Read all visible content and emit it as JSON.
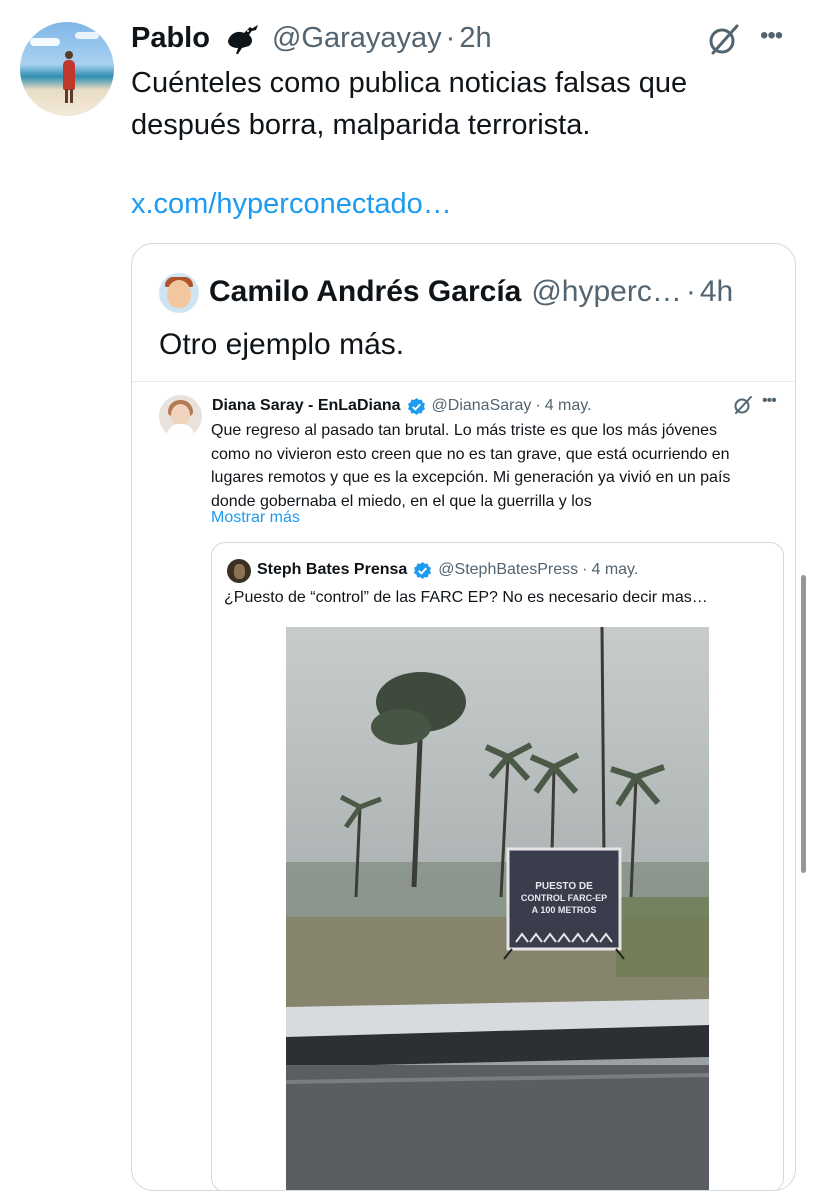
{
  "tweet": {
    "author_name": "Pablo",
    "author_handle": "@Garayayay",
    "separator": "·",
    "time": "2h",
    "text": "Cuénteles como publica noticias falsas que después borra, malparida terrorista.",
    "link_text": "x.com/hyperconectado…",
    "icons": {
      "badge": "bird-emoji-icon",
      "grok": "grok-icon",
      "more": "more-icon"
    }
  },
  "quote": {
    "author_name": "Camilo Andrés García",
    "author_handle": "@hyperc…",
    "separator": "·",
    "time": "4h",
    "text": "Otro ejemplo más.",
    "screenshot": {
      "author_name": "Diana Saray - EnLaDiana",
      "author_handle": "@DianaSaray",
      "separator": "·",
      "time": "4 may.",
      "lines": [
        "Que regreso al pasado tan brutal. Lo más triste es que los más jóvenes",
        "como no vivieron esto creen que no es tan grave, que está ocurriendo en",
        "lugares remotos y que es la excepción. Mi generación ya vivió en un país",
        "donde gobernaba el miedo, en el que la guerrilla y los"
      ],
      "show_more": "Mostrar más",
      "inner": {
        "author_name": "Steph Bates Prensa",
        "author_handle": "@StephBatesPress",
        "separator": "·",
        "time": "4 may.",
        "text": "¿Puesto de “control” de las FARC EP? No es necesario decir mas…",
        "photo_sign": [
          "PUESTO DE",
          "CONTROL FARC-EP",
          "A 100 METROS"
        ]
      }
    }
  },
  "colors": {
    "accent": "#1d9bf0",
    "secondary_text": "#536471",
    "border": "#cfd9de",
    "verified": "#1d9bf0"
  }
}
